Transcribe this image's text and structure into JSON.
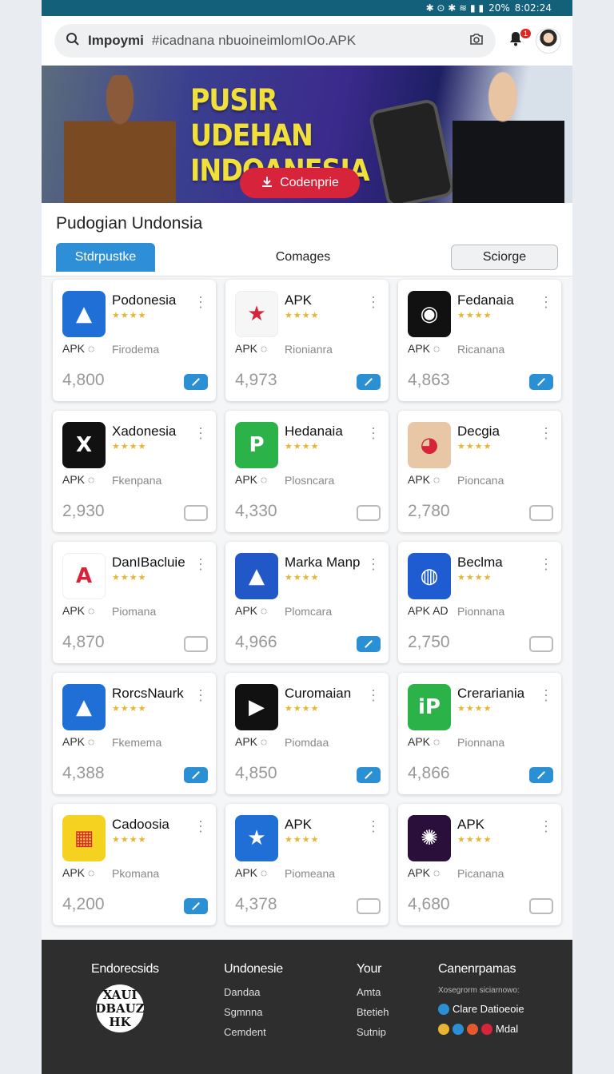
{
  "status": {
    "icons": "✱ ⊙ ✱ ≋ ▮ ▮",
    "battery": "20%",
    "time": "8:02:24"
  },
  "search": {
    "bold": "Impoymi",
    "text": "#icadnana nbuoineimlomIOo.APK"
  },
  "notifications": {
    "count": "1"
  },
  "banner": {
    "title": "PUSIR UDEHAN INDOANESIA",
    "cta": "Codenprie"
  },
  "section": {
    "title": "Pudogian Undonsia",
    "tabs": [
      "Stdrpustke",
      "Comages",
      "Sciorge"
    ]
  },
  "apps": [
    {
      "name": "Podonesia",
      "apk": "APK ◌",
      "publisher": "Firodema",
      "count": "4,800",
      "active": true,
      "icon_color": "#1f6fd6",
      "icon_glyph": "▲"
    },
    {
      "name": "APK",
      "apk": "APK ◌",
      "publisher": "Rionianra",
      "count": "4,973",
      "active": true,
      "icon_color": "#f6f6f6",
      "icon_glyph": "★"
    },
    {
      "name": "Fedanaia",
      "apk": "APK ◌",
      "publisher": "Ricanana",
      "count": "4,863",
      "active": true,
      "icon_color": "#111111",
      "icon_glyph": "◉"
    },
    {
      "name": "Xadonesia",
      "apk": "APK ◌",
      "publisher": "Fkenpana",
      "count": "2,930",
      "active": false,
      "icon_color": "#111111",
      "icon_glyph": "X"
    },
    {
      "name": "Hedanaia",
      "apk": "APK ◌",
      "publisher": "Plosncara",
      "count": "4,330",
      "active": false,
      "icon_color": "#2bb34a",
      "icon_glyph": "P"
    },
    {
      "name": "Decgia",
      "apk": "APK ◌",
      "publisher": "Pioncana",
      "count": "2,780",
      "active": false,
      "icon_color": "#e8c7a6",
      "icon_glyph": "◕"
    },
    {
      "name": "DanIBacluie",
      "apk": "APK ◌",
      "publisher": "Piomana",
      "count": "4,870",
      "active": false,
      "icon_color": "#ffffff",
      "icon_glyph": "A"
    },
    {
      "name": "Marka Manp",
      "apk": "APK ◌",
      "publisher": "Plomcara",
      "count": "4,966",
      "active": true,
      "icon_color": "#2257c8",
      "icon_glyph": "▲"
    },
    {
      "name": "Beclma",
      "apk": "APK AD",
      "publisher": "Pionnana",
      "count": "2,750",
      "active": false,
      "icon_color": "#1f5bd1",
      "icon_glyph": "◍"
    },
    {
      "name": "RorcsNaurk",
      "apk": "APK ◌",
      "publisher": "Fkemema",
      "count": "4,388",
      "active": true,
      "icon_color": "#1f6fd6",
      "icon_glyph": "▲"
    },
    {
      "name": "Curomaian",
      "apk": "APK ◌",
      "publisher": "Piomdaa",
      "count": "4,850",
      "active": true,
      "icon_color": "#111111",
      "icon_glyph": "▶"
    },
    {
      "name": "Crerariania",
      "apk": "APK ◌",
      "publisher": "Pionnana",
      "count": "4,866",
      "active": true,
      "icon_color": "#2bb34a",
      "icon_glyph": "iP"
    },
    {
      "name": "Cadoosia",
      "apk": "APK ◌",
      "publisher": "Pkomana",
      "count": "4,200",
      "active": true,
      "icon_color": "#f4d21f",
      "icon_glyph": "▦"
    },
    {
      "name": "APK",
      "apk": "APK ◌",
      "publisher": "Piomeana",
      "count": "4,378",
      "active": false,
      "icon_color": "#1f6fd6",
      "icon_glyph": "★"
    },
    {
      "name": "APK",
      "apk": "APK ◌",
      "publisher": "Picanana",
      "count": "4,680",
      "active": false,
      "icon_color": "#2a0f3a",
      "icon_glyph": "✺"
    }
  ],
  "footer": {
    "col1": {
      "title": "Endorecsids",
      "logo": "XAUI DBAUZ HK"
    },
    "col2": {
      "title": "Undonesie",
      "links": [
        "Dandaa",
        "Sgmnna",
        "Cemdent"
      ]
    },
    "col3": {
      "title": "Your",
      "links": [
        "Amta",
        "Btetieh",
        "Sutnip"
      ]
    },
    "col4": {
      "title": "Canenrpamas",
      "sub": "Xosegrorm siciarnowo:",
      "line1": "Clare Datioeoie",
      "line2": "Mdal"
    }
  }
}
